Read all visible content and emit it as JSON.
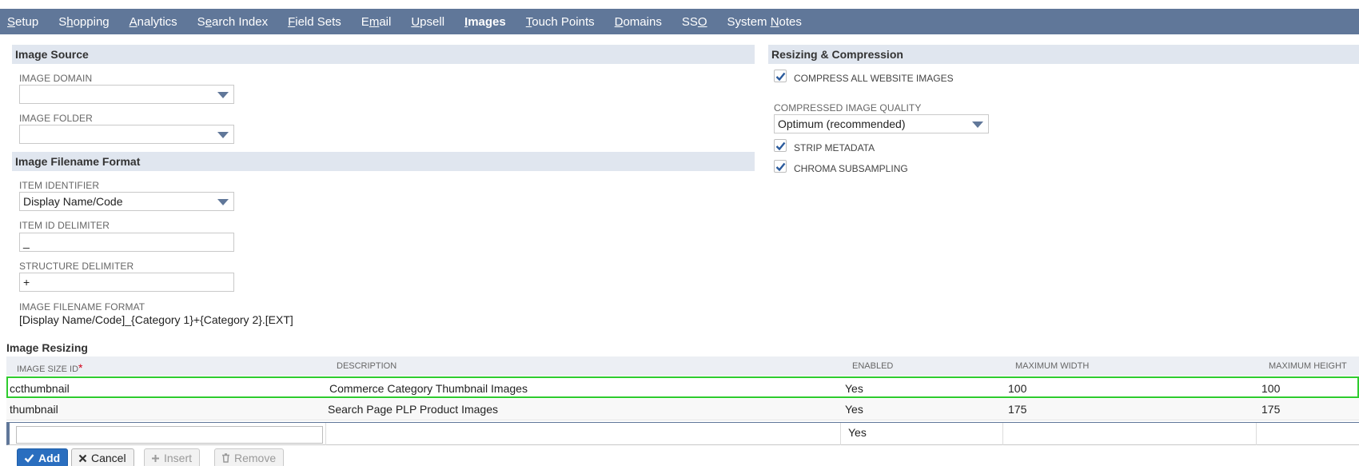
{
  "nav": {
    "items": [
      {
        "pre": "",
        "ul": "S",
        "post": "etup",
        "active": false
      },
      {
        "pre": "S",
        "ul": "h",
        "post": "opping",
        "active": false
      },
      {
        "pre": "",
        "ul": "A",
        "post": "nalytics",
        "active": false
      },
      {
        "pre": "S",
        "ul": "e",
        "post": "arch Index",
        "active": false
      },
      {
        "pre": "",
        "ul": "F",
        "post": "ield Sets",
        "active": false
      },
      {
        "pre": "E",
        "ul": "m",
        "post": "ail",
        "active": false
      },
      {
        "pre": "",
        "ul": "U",
        "post": "psell",
        "active": false
      },
      {
        "pre": "",
        "ul": "I",
        "post": "mages",
        "active": true
      },
      {
        "pre": "",
        "ul": "T",
        "post": "ouch Points",
        "active": false
      },
      {
        "pre": "",
        "ul": "D",
        "post": "omains",
        "active": false
      },
      {
        "pre": "SS",
        "ul": "O",
        "post": "",
        "active": false
      },
      {
        "pre": "System ",
        "ul": "N",
        "post": "otes",
        "active": false
      }
    ]
  },
  "image_source": {
    "title": "Image Source",
    "domain_label": "IMAGE DOMAIN",
    "domain_value": "",
    "folder_label": "IMAGE FOLDER",
    "folder_value": ""
  },
  "filename_format": {
    "title": "Image Filename Format",
    "item_identifier_label": "ITEM IDENTIFIER",
    "item_identifier_value": "Display Name/Code",
    "item_id_delimiter_label": "ITEM ID DELIMITER",
    "item_id_delimiter_value": "_",
    "structure_delimiter_label": "STRUCTURE DELIMITER",
    "structure_delimiter_value": "+",
    "format_label": "IMAGE FILENAME FORMAT",
    "format_value": "[Display Name/Code]_{Category 1}+{Category 2}.[EXT]"
  },
  "compression": {
    "title": "Resizing & Compression",
    "compress_all_label": "COMPRESS ALL WEBSITE IMAGES",
    "compress_all_checked": true,
    "quality_label": "COMPRESSED IMAGE QUALITY",
    "quality_value": "Optimum (recommended)",
    "strip_metadata_label": "STRIP METADATA",
    "strip_metadata_checked": true,
    "chroma_label": "CHROMA SUBSAMPLING",
    "chroma_checked": true
  },
  "resizing": {
    "title": "Image Resizing",
    "columns": {
      "id": "IMAGE SIZE ID",
      "required_mark": "*",
      "description": "DESCRIPTION",
      "enabled": "ENABLED",
      "max_width": "MAXIMUM WIDTH",
      "max_height": "MAXIMUM HEIGHT"
    },
    "rows": [
      {
        "id": "ccthumbnail",
        "description": "Commerce Category Thumbnail Images",
        "enabled": "Yes",
        "max_width": "100",
        "max_height": "100"
      },
      {
        "id": "thumbnail",
        "description": "Search Page PLP Product Images",
        "enabled": "Yes",
        "max_width": "175",
        "max_height": "175"
      }
    ],
    "new_row": {
      "enabled": "Yes"
    }
  },
  "buttons": {
    "add": "Add",
    "cancel": "Cancel",
    "insert": "Insert",
    "remove": "Remove"
  },
  "colors": {
    "nav_bg": "#607799",
    "section_bg": "#e0e6ef",
    "selected_row_border": "#2ecc2e",
    "primary_button": "#2a6ebf"
  }
}
